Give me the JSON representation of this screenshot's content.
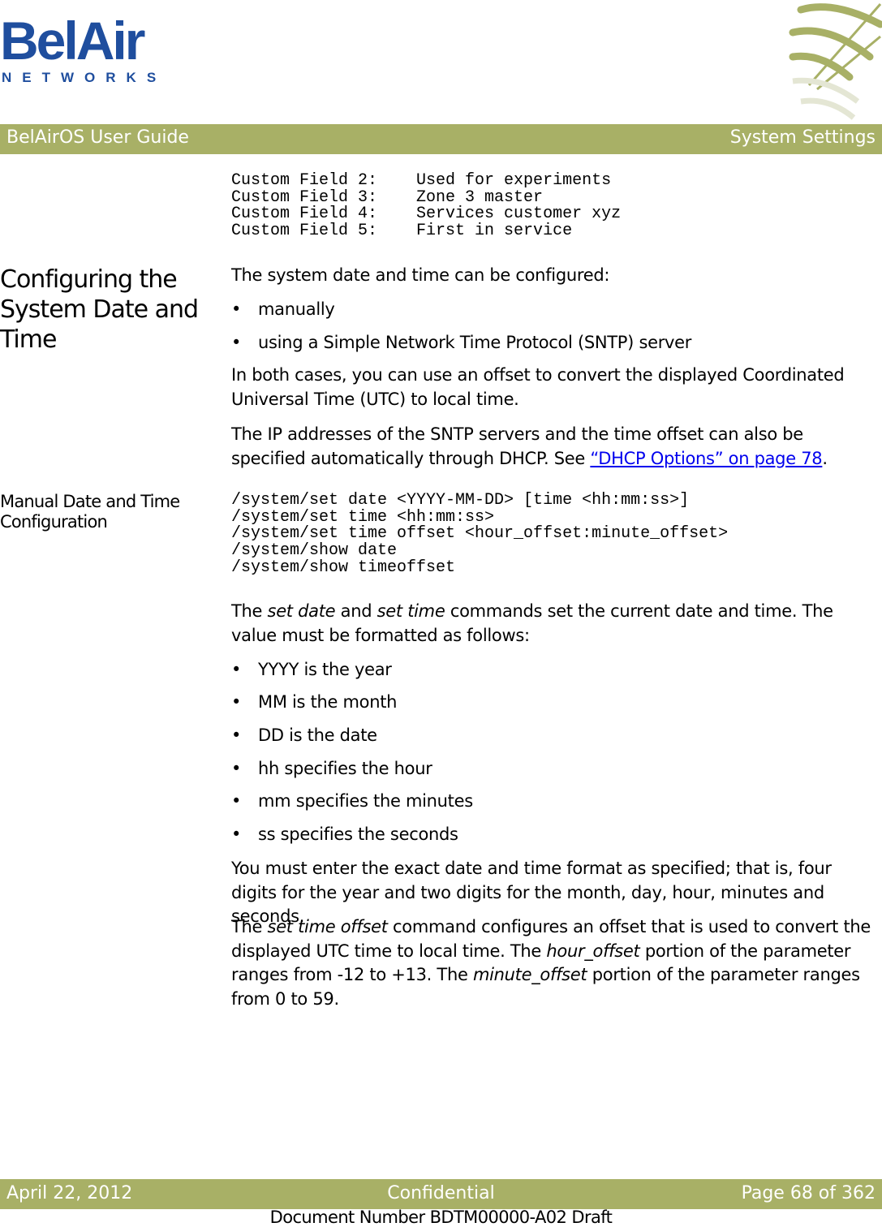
{
  "logo": {
    "brand": "BelAir",
    "sub": "NETWORKS"
  },
  "header": {
    "left": "BelAirOS User Guide",
    "right": "System Settings"
  },
  "code_block_1": [
    "Custom Field 2:    Used for experiments",
    "Custom Field 3:    Zone 3 master",
    "Custom Field 4:    Services customer xyz",
    "Custom Field 5:    First in service"
  ],
  "section1": {
    "heading": "Configuring the System Date and Time",
    "intro": "The system date and time can be configured:",
    "bullets": [
      "manually",
      "using a Simple Network Time Protocol (SNTP) server"
    ],
    "para2": "In both cases, you can use an offset to convert the displayed Coordinated Universal Time (UTC) to local time.",
    "para3_pre": "The IP addresses of the SNTP servers and the time offset can also be specified automatically through DHCP. See ",
    "para3_link": "“DHCP Options” on page 78",
    "para3_post": "."
  },
  "section2": {
    "heading": "Manual Date and Time Configuration",
    "commands": [
      "/system/set date <YYYY-MM-DD> [time <hh:mm:ss>]",
      "/system/set time <hh:mm:ss>",
      "/system/set time offset <hour_offset:minute_offset>",
      "/system/show date",
      "/system/show timeoffset"
    ],
    "p1_a": "The ",
    "p1_em1": "set date",
    "p1_b": " and ",
    "p1_em2": "set time",
    "p1_c": " commands set the current date and time. The value must be formatted as follows:",
    "bullets": [
      "YYYY is the year",
      "MM is the month",
      "DD is the date",
      "hh specifies the hour",
      "mm specifies the minutes",
      "ss specifies the seconds"
    ],
    "p2": "You must enter the exact date and time format as specified; that is, four digits for the year and two digits for the month, day, hour, minutes and seconds.",
    "p3_a": "The ",
    "p3_em1": "set time offset",
    "p3_b": " command configures an offset that is used to convert the displayed UTC time to local time. The ",
    "p3_em2": "hour_offset",
    "p3_c": " portion of the parameter ranges from -12 to +13. The ",
    "p3_em3": "minute_offset",
    "p3_d": " portion of the parameter ranges from 0 to 59."
  },
  "footer": {
    "date": "April 22, 2012",
    "label": "Confidential",
    "page": "Page 68 of 362",
    "doc_number": "Document Number BDTM00000-A02 Draft"
  }
}
